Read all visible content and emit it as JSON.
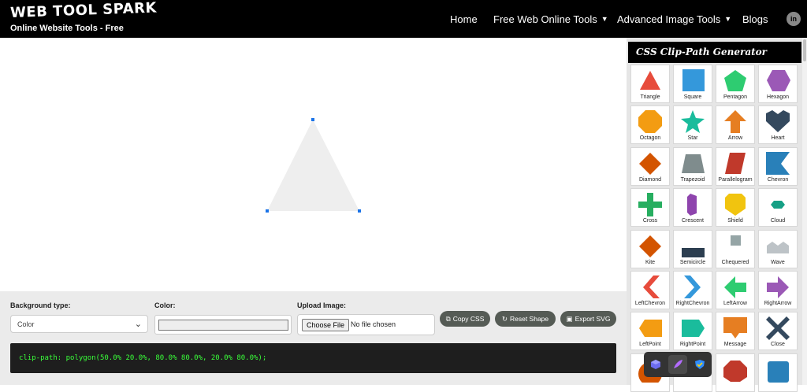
{
  "header": {
    "brand_title": "WEB TOOL SPARK",
    "brand_subtitle": "Online Website Tools - Free",
    "nav": [
      {
        "label": "Home",
        "dropdown": false
      },
      {
        "label": "Free Web Online Tools",
        "dropdown": true
      },
      {
        "label": "Advanced Image Tools",
        "dropdown": true
      },
      {
        "label": "Blogs",
        "dropdown": false
      }
    ],
    "social_icon": "linkedin-icon"
  },
  "canvas": {
    "shape": "triangle",
    "shape_color": "#eeeeee",
    "handle_color": "#1a73e8"
  },
  "controls": {
    "background_type_label": "Background type:",
    "background_type_value": "Color",
    "color_label": "Color:",
    "color_value": "#eeeeee",
    "upload_label": "Upload Image:",
    "choose_file": "Choose File",
    "file_status": "No file chosen",
    "buttons": {
      "copy_css": "Copy CSS",
      "reset_shape": "Reset Shape",
      "export_svg": "Export SVG"
    },
    "css_output": "clip-path: polygon(50.0% 20.0%, 80.0% 80.0%, 20.0% 80.0%);"
  },
  "panel": {
    "title": "CSS Clip-Path Generator",
    "shapes": [
      {
        "name": "Triangle",
        "color": "#e74c3c"
      },
      {
        "name": "Square",
        "color": "#3498db"
      },
      {
        "name": "Pentagon",
        "color": "#2ecc71"
      },
      {
        "name": "Hexagon",
        "color": "#9b59b6"
      },
      {
        "name": "Octagon",
        "color": "#f39c12"
      },
      {
        "name": "Star",
        "color": "#1abc9c"
      },
      {
        "name": "Arrow",
        "color": "#e67e22"
      },
      {
        "name": "Heart",
        "color": "#34495e"
      },
      {
        "name": "Diamond",
        "color": "#d35400"
      },
      {
        "name": "Trapezoid",
        "color": "#7f8c8d"
      },
      {
        "name": "Parallelogram",
        "color": "#c0392b"
      },
      {
        "name": "Chevron",
        "color": "#2980b9"
      },
      {
        "name": "Cross",
        "color": "#27ae60"
      },
      {
        "name": "Crescent",
        "color": "#8e44ad"
      },
      {
        "name": "Shield",
        "color": "#f1c40f"
      },
      {
        "name": "Cloud",
        "color": "#16a085"
      },
      {
        "name": "Kite",
        "color": "#d35400"
      },
      {
        "name": "Semicircle",
        "color": "#2c3e50"
      },
      {
        "name": "Chequered",
        "color": "#95a5a6"
      },
      {
        "name": "Wave",
        "color": "#bdc3c7"
      },
      {
        "name": "LeftChevron",
        "color": "#e74c3c"
      },
      {
        "name": "RightChevron",
        "color": "#3498db"
      },
      {
        "name": "LeftArrow",
        "color": "#2ecc71"
      },
      {
        "name": "RightArrow",
        "color": "#9b59b6"
      },
      {
        "name": "LeftPoint",
        "color": "#f39c12"
      },
      {
        "name": "RightPoint",
        "color": "#1abc9c"
      },
      {
        "name": "Message",
        "color": "#e67e22"
      },
      {
        "name": "Close",
        "color": "#34495e"
      },
      {
        "name": "",
        "color": "#d35400"
      },
      {
        "name": "",
        "color": "#ffffff"
      },
      {
        "name": "",
        "color": "#c0392b"
      },
      {
        "name": "",
        "color": "#2980b9"
      }
    ]
  },
  "floating_toolbar": {
    "icons": [
      "cube-icon",
      "feather-icon",
      "shield-check-icon"
    ]
  }
}
